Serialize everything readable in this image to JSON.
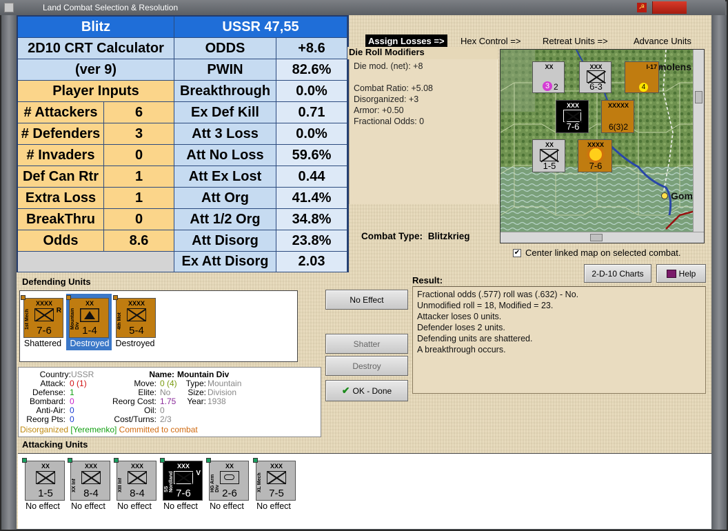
{
  "window": {
    "title": "Land Combat Selection & Resolution",
    "flag_glyph": "☭"
  },
  "crt": {
    "blitz": "Blitz",
    "ussr": "USSR 47,55",
    "calc_title_1": "2D10 CRT Calculator",
    "calc_title_2": "(ver 9)",
    "player_inputs": "Player Inputs",
    "inputs": [
      {
        "label": "# Attackers",
        "value": "6"
      },
      {
        "label": "# Defenders",
        "value": "3"
      },
      {
        "label": "# Invaders",
        "value": "0"
      },
      {
        "label": "Def Can Rtr",
        "value": "1"
      },
      {
        "label": "Extra Loss",
        "value": "1"
      },
      {
        "label": "BreakThru",
        "value": "0"
      },
      {
        "label": "Odds",
        "value": "8.6"
      }
    ],
    "results": [
      {
        "label": "ODDS",
        "value": "+8.6"
      },
      {
        "label": "PWIN",
        "value": "82.6%"
      },
      {
        "label": "Breakthrough",
        "value": "0.0%"
      },
      {
        "label": "Ex Def Kill",
        "value": "0.71"
      },
      {
        "label": "Att 3 Loss",
        "value": "0.0%"
      },
      {
        "label": "Att No Loss",
        "value": "59.6%"
      },
      {
        "label": "Att Ex Lost",
        "value": "0.44"
      },
      {
        "label": "Att Org",
        "value": "41.4%"
      },
      {
        "label": "Att 1/2 Org",
        "value": "34.8%"
      },
      {
        "label": "Att Disorg",
        "value": "23.8%"
      },
      {
        "label": "Ex Att Disorg",
        "value": "2.03"
      }
    ]
  },
  "toolbar": {
    "assign_losses": "Assign Losses =>",
    "hex_control": "Hex Control =>",
    "retreat_units": "Retreat Units =>",
    "advance_units": "Advance Units"
  },
  "modifiers": {
    "title": "Die Roll Modifiers",
    "lines": [
      "Die mod. (net): +8",
      "",
      "Combat Ratio: +5.08",
      "Disorganized: +3",
      "Armor: +0.50",
      "Fractional Odds: 0"
    ]
  },
  "map": {
    "labels": {
      "smolensk": "molens",
      "gomel": "Gom"
    },
    "counters": [
      {
        "size": "XX",
        "str": "2",
        "mark": "3",
        "top": "3"
      },
      {
        "size": "XXX",
        "str": "6-3",
        "top": "3"
      },
      {
        "size": "I-17",
        "str": "4",
        "top": "3"
      },
      {
        "size": "XXX",
        "str": "7-6",
        "top": "4"
      },
      {
        "size": "XXXXX",
        "str": "6(3)2",
        "top": "2"
      },
      {
        "size": "XX",
        "str": "1-5",
        "top": "3"
      },
      {
        "size": "XXXX",
        "str": "7-6",
        "top": "R"
      }
    ]
  },
  "combat_type_label": "Combat Type:",
  "combat_type_value": "Blitzkrieg",
  "center_map": "Center linked map on selected combat.",
  "buttons": {
    "charts": "2-D-10 Charts",
    "help": "Help",
    "no_effect": "No Effect",
    "shatter": "Shatter",
    "destroy": "Destroy",
    "ok_done": "OK - Done"
  },
  "defending": {
    "label": "Defending Units",
    "units": [
      {
        "name": "1st Mech",
        "size": "XXXX",
        "str": "7-6",
        "tag": "R",
        "status": "Shattered"
      },
      {
        "name": "Mountain Div",
        "size": "XX",
        "str": "1-4",
        "tag": "",
        "status": "Destroyed"
      },
      {
        "name": "4th Mot",
        "size": "XXXX",
        "str": "5-4",
        "tag": "",
        "status": "Destroyed"
      }
    ]
  },
  "attacking": {
    "label": "Attacking Units",
    "units": [
      {
        "name": "",
        "size": "XX",
        "str": "1-5",
        "status": "No effect"
      },
      {
        "name": "XX Inf",
        "size": "XXX",
        "str": "8-4",
        "status": "No effect"
      },
      {
        "name": "XIII Inf",
        "size": "XXX",
        "str": "8-4",
        "status": "No effect"
      },
      {
        "name": "SS Nordland",
        "size": "XXX",
        "str": "7-6",
        "tag": "V",
        "status": "No effect"
      },
      {
        "name": "HG Arm Div",
        "size": "XX",
        "str": "2-6",
        "status": "No effect"
      },
      {
        "name": "XL Mech",
        "size": "XXX",
        "str": "7-5",
        "status": "No effect"
      }
    ]
  },
  "info": {
    "country_k": "Country:",
    "country_v": "USSR",
    "attack_k": "Attack:",
    "attack_v": "0",
    "attack_v2": "(1)",
    "defense_k": "Defense:",
    "defense_v": "1",
    "bombard_k": "Bombard:",
    "bombard_v": "0",
    "antiair_k": "Anti-Air:",
    "antiair_v": "0",
    "reorg_k": "Reorg Pts:",
    "reorg_v": "0",
    "name_k": "Name:",
    "name_v": "Mountain Div",
    "move_k": "Move:",
    "move_v": "0 (4)",
    "elite_k": "Elite:",
    "elite_v": "No",
    "reorgcost_k": "Reorg Cost:",
    "reorgcost_v": "1.75",
    "oil_k": "Oil:",
    "oil_v": "0",
    "costturns_k": "Cost/Turns:",
    "costturns_v": "2/3",
    "type_k": "Type:",
    "type_v": "Mountain",
    "size_k": "Size:",
    "size_v": "Division",
    "year_k": "Year:",
    "year_v": "1938",
    "status_1": "Disorganized",
    "status_2": "[Yeremenko]",
    "status_3": "Committed to combat"
  },
  "result": {
    "label": "Result:",
    "lines": [
      "Fractional odds (.577) roll was (.632)  - No.",
      "Unmodified roll = 18, Modified = 23.",
      "Attacker loses 0 units.",
      "Defender loses 2 units.",
      "Defending units are shattered.",
      "A breakthrough occurs."
    ]
  },
  "colors": {
    "crt_header": "#1f6ed8",
    "crt_light": "#c6dbf1",
    "crt_input": "#fbd58a",
    "parchment": "#e6d8b8",
    "german_unit": "#b8b8b8",
    "soviet_unit": "#c07c10"
  }
}
